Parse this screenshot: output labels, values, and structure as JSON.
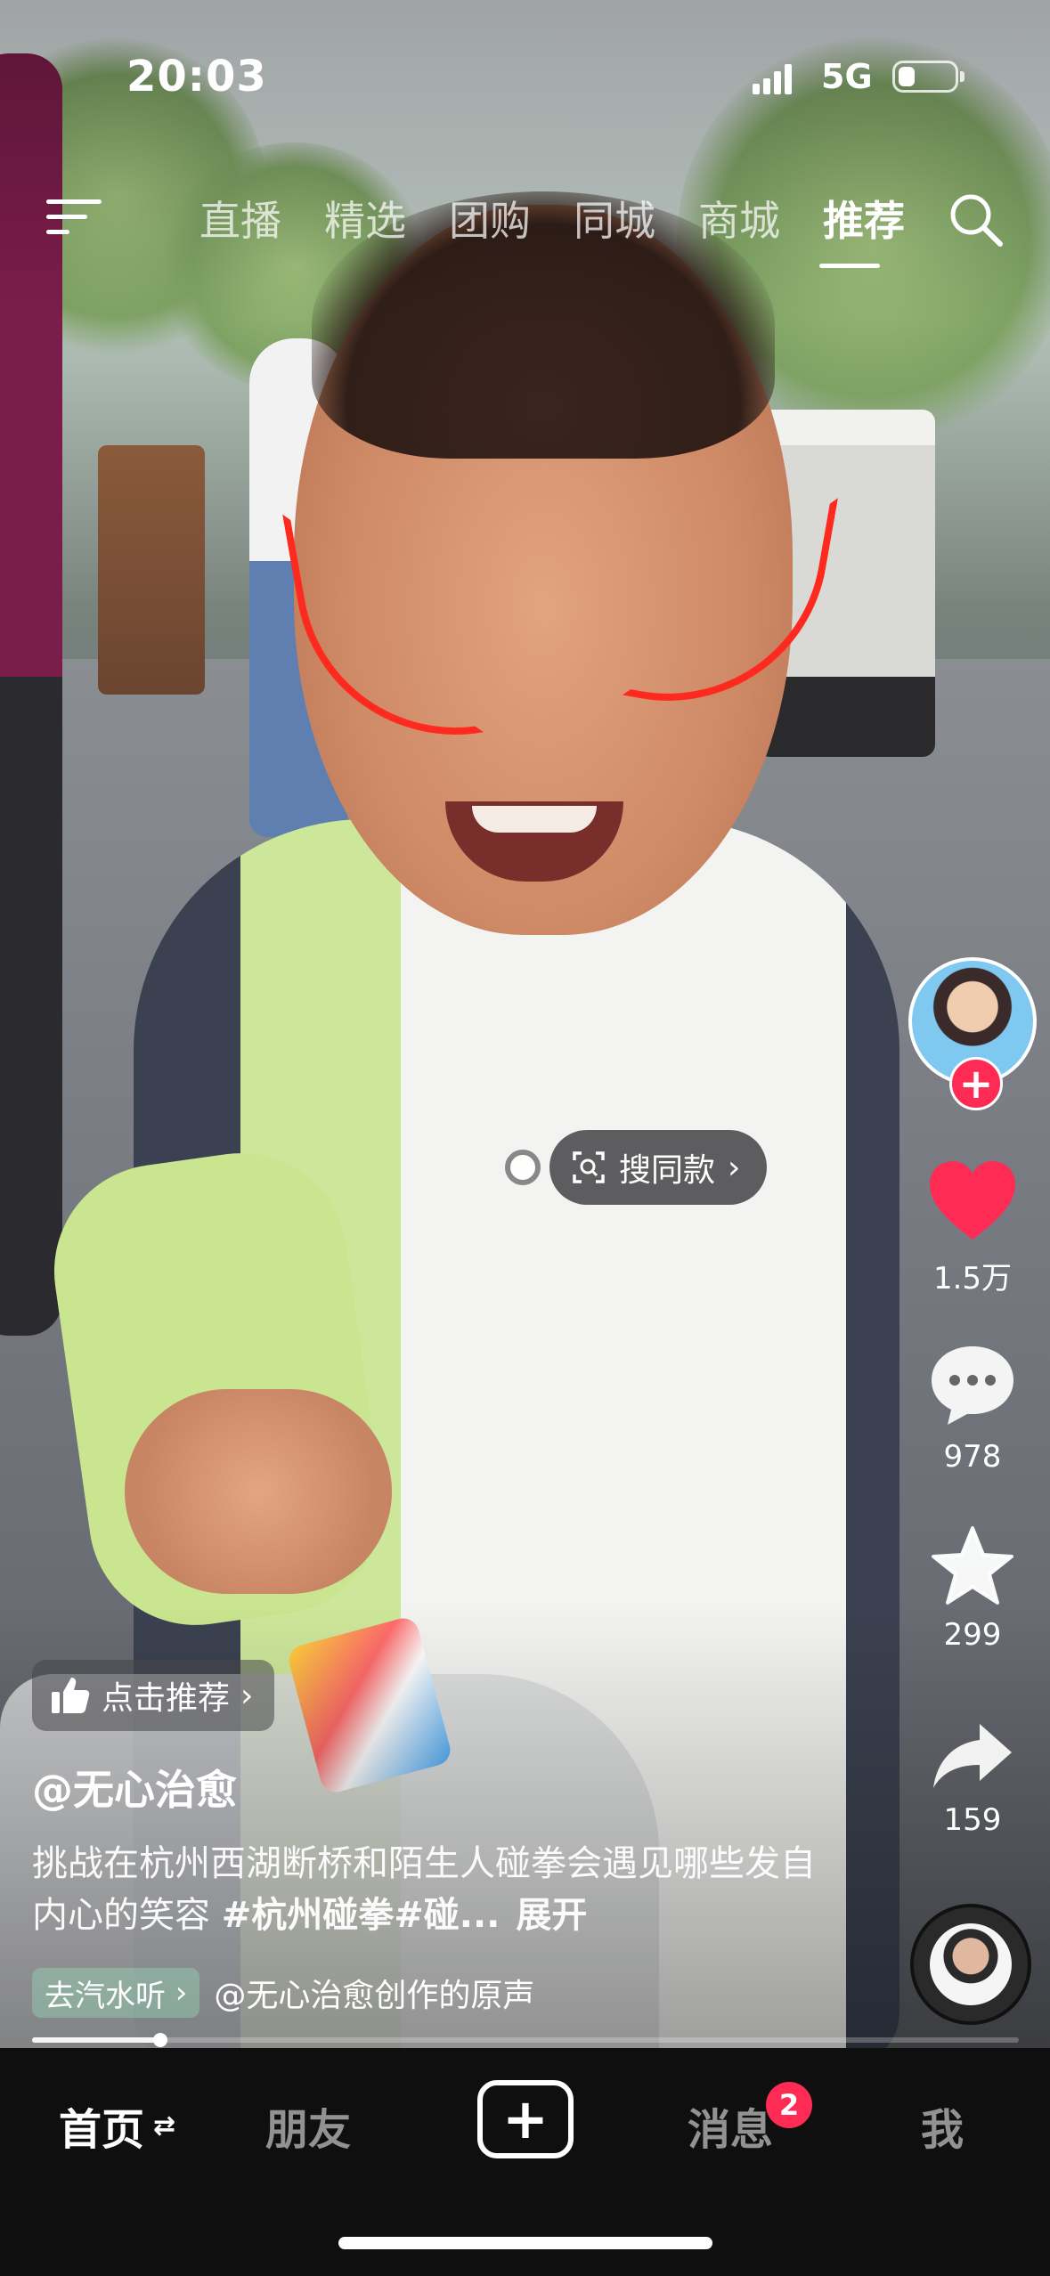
{
  "status_bar": {
    "time": "20:03",
    "network": "5G",
    "battery_level": 0.3
  },
  "top_nav": {
    "tabs": [
      {
        "label": "直播",
        "active": false
      },
      {
        "label": "精选",
        "active": false
      },
      {
        "label": "团购",
        "active": false
      },
      {
        "label": "同城",
        "active": false
      },
      {
        "label": "商城",
        "active": false
      },
      {
        "label": "推荐",
        "active": true
      }
    ],
    "menu_icon": "menu-icon",
    "search_icon": "search-icon"
  },
  "overlay": {
    "search_same_label": "搜同款",
    "recommend_label": "点击推荐"
  },
  "actions": {
    "like_count": "1.5万",
    "comment_count": "978",
    "favorite_count": "299",
    "share_count": "159",
    "follow_symbol": "+"
  },
  "caption": {
    "author": "@无心治愈",
    "description": "挑战在杭州西湖断桥和陌生人碰拳会遇见哪些发自内心的笑容 ",
    "tags": "#杭州碰拳#碰...",
    "expand": "展开",
    "music_tag": "去汽水听",
    "music_title": "@无心治愈创作的原声",
    "progress": 0.13
  },
  "tab_bar": {
    "home": "首页",
    "friends": "朋友",
    "add_symbol": "+",
    "messages": "消息",
    "messages_badge": "2",
    "me": "我"
  },
  "colors": {
    "accent": "#fe2c55",
    "annotation_red": "#ff2a1f"
  }
}
